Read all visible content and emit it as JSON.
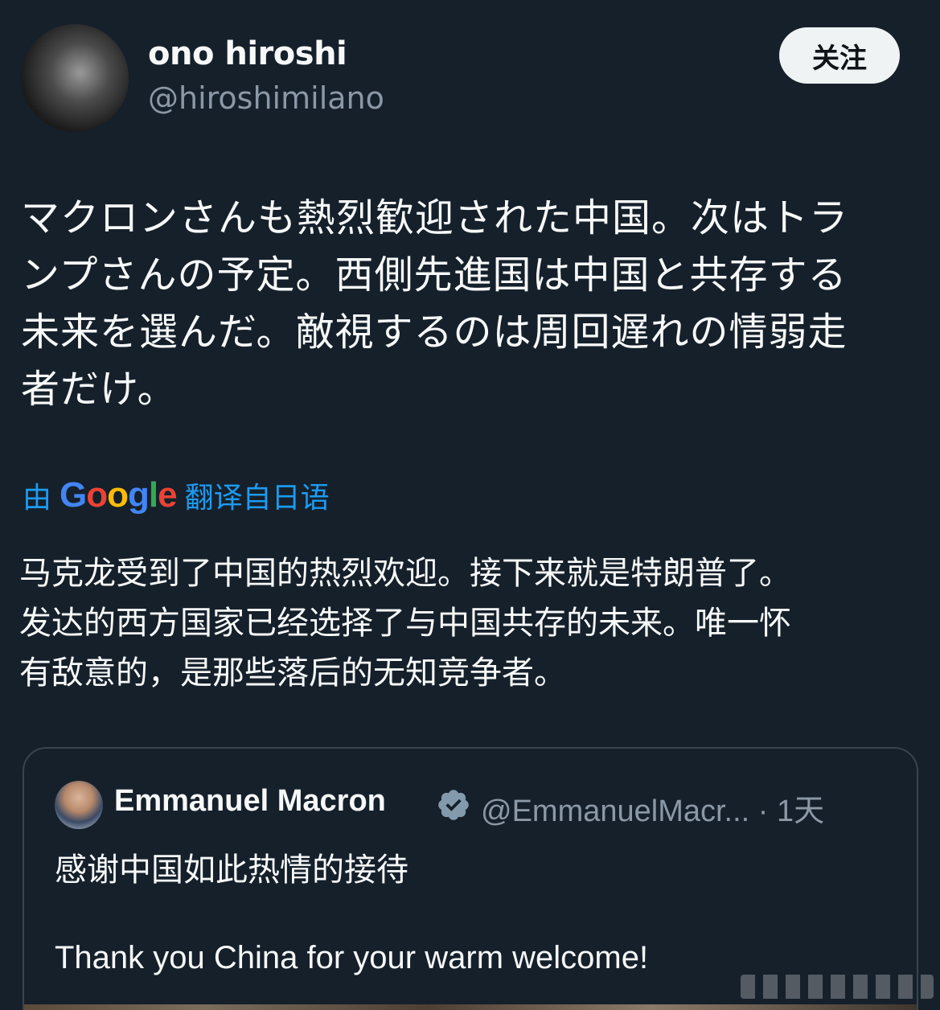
{
  "author": {
    "display_name": "ono hiroshi",
    "handle": "@hiroshimilano",
    "follow_label": "关注"
  },
  "tweet": {
    "lines": [
      "マクロンさんも熱烈歓迎された中国。次はトラ",
      "ンプさんの予定。西側先進国は中国と共存する",
      "未来を選んだ。敵視するのは周回遅れの情弱走",
      "者だけ。"
    ]
  },
  "translation": {
    "prefix": "由",
    "provider": "Google",
    "suffix": "翻译自日语",
    "lines": [
      "马克龙受到了中国的热烈欢迎。接下来就是特朗普了。",
      "发达的西方国家已经选择了与中国共存的未来。唯一怀",
      "有敌意的，是那些落后的无知竞争者。"
    ]
  },
  "quoted_tweet": {
    "display_name": "Emmanuel Macron",
    "handle_time": "@EmmanuelMacr... · 1天",
    "text_zh": "感谢中国如此热情的接待",
    "text_en": "Thank you China for your warm welcome!",
    "verified_icon": "verified-badge-icon"
  },
  "colors": {
    "background": "#15202b",
    "link": "#1d9bf0",
    "secondary_text": "#8b98a5",
    "border": "#38444d"
  }
}
